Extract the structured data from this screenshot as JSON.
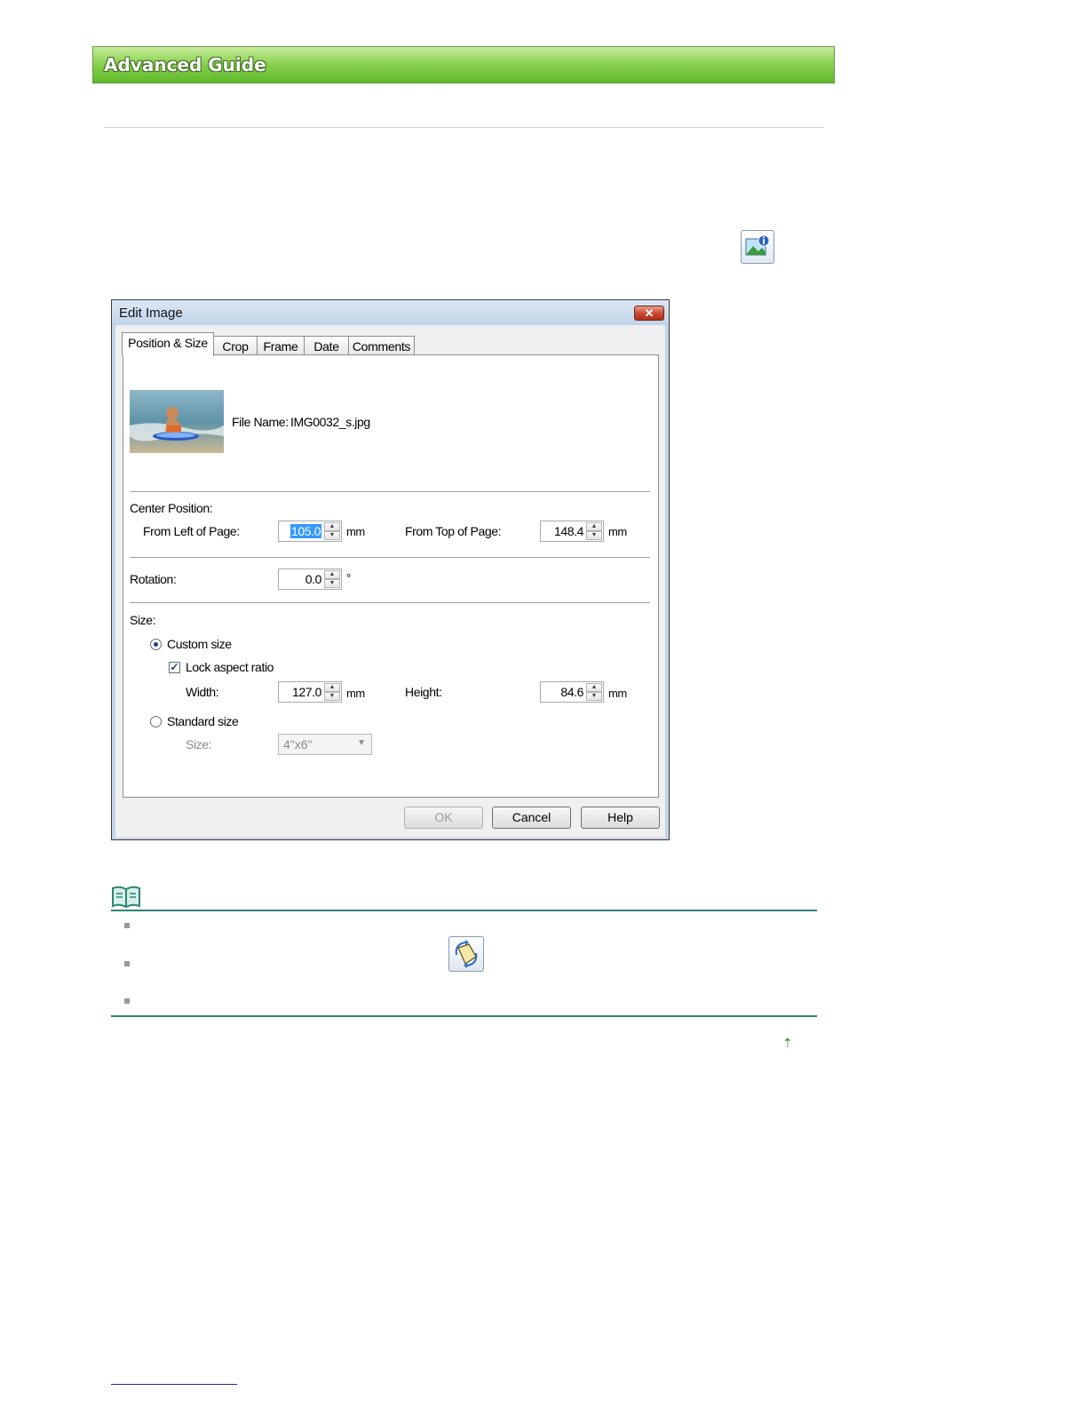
{
  "header": {
    "title": "Advanced Guide"
  },
  "icons": {
    "image_info": "image-info-icon",
    "note": "note-book-icon",
    "rotate": "rotate-icon",
    "back_to_top": "up-arrow-icon"
  },
  "dialog": {
    "title": "Edit Image",
    "close_label": "✕",
    "tabs": [
      {
        "label": "Position & Size",
        "active": true
      },
      {
        "label": "Crop"
      },
      {
        "label": "Frame"
      },
      {
        "label": "Date"
      },
      {
        "label": "Comments"
      }
    ],
    "file_name_label": "File Name:",
    "file_name": "IMG0032_s.jpg",
    "center_position": {
      "heading": "Center Position:",
      "left_label": "From Left of Page:",
      "left_value": "105.0",
      "left_unit": "mm",
      "top_label": "From Top of Page:",
      "top_value": "148.4",
      "top_unit": "mm"
    },
    "rotation": {
      "label": "Rotation:",
      "value": "0.0",
      "unit": "°"
    },
    "size": {
      "heading": "Size:",
      "custom_label": "Custom size",
      "custom_selected": true,
      "lock_label": "Lock aspect ratio",
      "lock_checked": true,
      "width_label": "Width:",
      "width_value": "127.0",
      "width_unit": "mm",
      "height_label": "Height:",
      "height_value": "84.6",
      "height_unit": "mm",
      "standard_label": "Standard size",
      "standard_size_label": "Size:",
      "standard_size_value": "4\"x6\""
    },
    "buttons": {
      "ok": "OK",
      "cancel": "Cancel",
      "help": "Help"
    }
  },
  "colors": {
    "banner_green": "#5fb828",
    "note_rule": "#2f8276",
    "selection": "#3399ff"
  }
}
